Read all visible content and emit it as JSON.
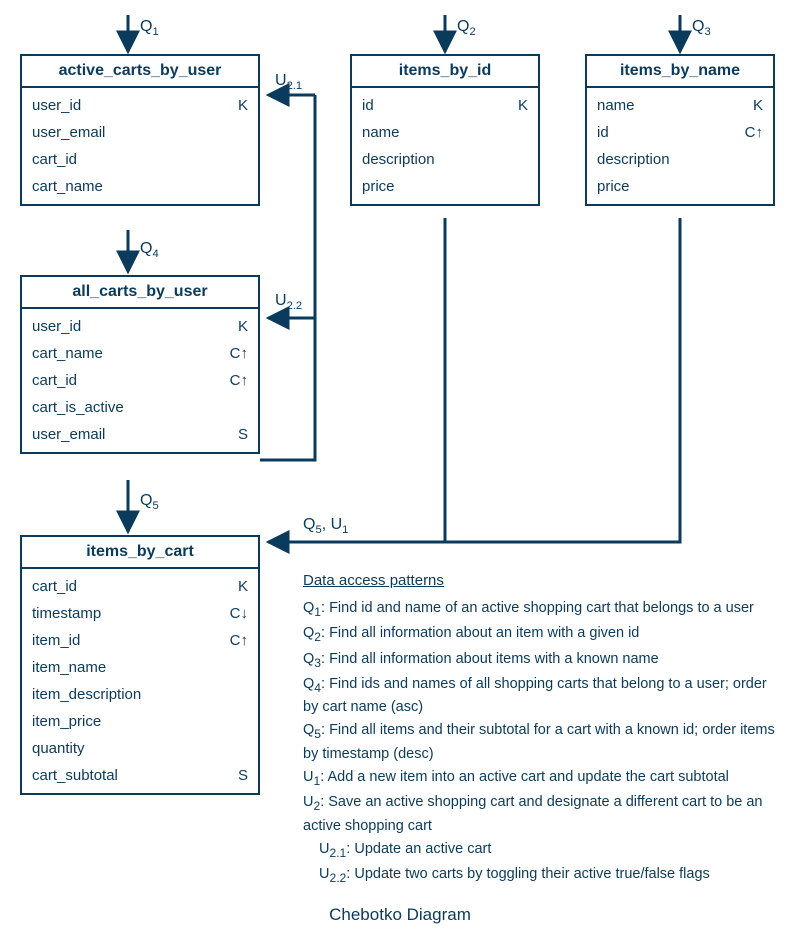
{
  "caption": "Chebotko Diagram",
  "labels": {
    "q1": "Q<sub>1</sub>",
    "q2": "Q<sub>2</sub>",
    "q3": "Q<sub>3</sub>",
    "q4": "Q<sub>4</sub>",
    "q5": "Q<sub>5</sub>",
    "u21": "U<sub>2.1</sub>",
    "u22": "U<sub>2.2</sub>",
    "q5u1": "Q<sub>5</sub>, U<sub>1</sub>"
  },
  "tables": {
    "t1": {
      "name": "active_carts_by_user",
      "rows": [
        {
          "col": "user_id",
          "key": "K"
        },
        {
          "col": "user_email",
          "key": ""
        },
        {
          "col": "cart_id",
          "key": ""
        },
        {
          "col": "cart_name",
          "key": ""
        }
      ]
    },
    "t2": {
      "name": "items_by_id",
      "rows": [
        {
          "col": "id",
          "key": "K"
        },
        {
          "col": "name",
          "key": ""
        },
        {
          "col": "description",
          "key": ""
        },
        {
          "col": "price",
          "key": ""
        }
      ]
    },
    "t3": {
      "name": "items_by_name",
      "rows": [
        {
          "col": "name",
          "key": "K"
        },
        {
          "col": "id",
          "key": "C↑"
        },
        {
          "col": "description",
          "key": ""
        },
        {
          "col": "price",
          "key": ""
        }
      ]
    },
    "t4": {
      "name": "all_carts_by_user",
      "rows": [
        {
          "col": "user_id",
          "key": "K"
        },
        {
          "col": "cart_name",
          "key": "C↑"
        },
        {
          "col": "cart_id",
          "key": "C↑"
        },
        {
          "col": "cart_is_active",
          "key": ""
        },
        {
          "col": "user_email",
          "key": "S"
        }
      ]
    },
    "t5": {
      "name": "items_by_cart",
      "rows": [
        {
          "col": "cart_id",
          "key": "K"
        },
        {
          "col": "timestamp",
          "key": "C↓"
        },
        {
          "col": "item_id",
          "key": "C↑"
        },
        {
          "col": "item_name",
          "key": ""
        },
        {
          "col": "item_description",
          "key": ""
        },
        {
          "col": "item_price",
          "key": ""
        },
        {
          "col": "quantity",
          "key": ""
        },
        {
          "col": "cart_subtotal",
          "key": "S"
        }
      ]
    }
  },
  "patterns": {
    "header": "Data access patterns",
    "q1": {
      "label": "Q<sub>1</sub>:",
      "text": "Find id and name of an active shopping cart that belongs to a user"
    },
    "q2": {
      "label": "Q<sub>2</sub>:",
      "text": "Find all information about an item with a given id"
    },
    "q3": {
      "label": "Q<sub>3</sub>:",
      "text": "Find all information about items with a known name"
    },
    "q4": {
      "label": "Q<sub>4</sub>:",
      "text": "Find ids and names of all shopping carts that belong to a user; order by cart name (asc)"
    },
    "q5": {
      "label": "Q<sub>5</sub>:",
      "text": "Find all items and their subtotal for a cart with a known id; order items by timestamp (desc)"
    },
    "u1": {
      "label": "U<sub>1</sub>:",
      "text": "Add a new item into an active cart and update the cart subtotal"
    },
    "u2": {
      "label": "U<sub>2</sub>:",
      "text": "Save an active shopping cart and designate a different cart to be an active shopping cart"
    },
    "u21": {
      "label": "U<sub>2.1</sub>:",
      "text": "Update an active cart"
    },
    "u22": {
      "label": "U<sub>2.2</sub>:",
      "text": "Update two carts by toggling their active true/false flags"
    }
  }
}
